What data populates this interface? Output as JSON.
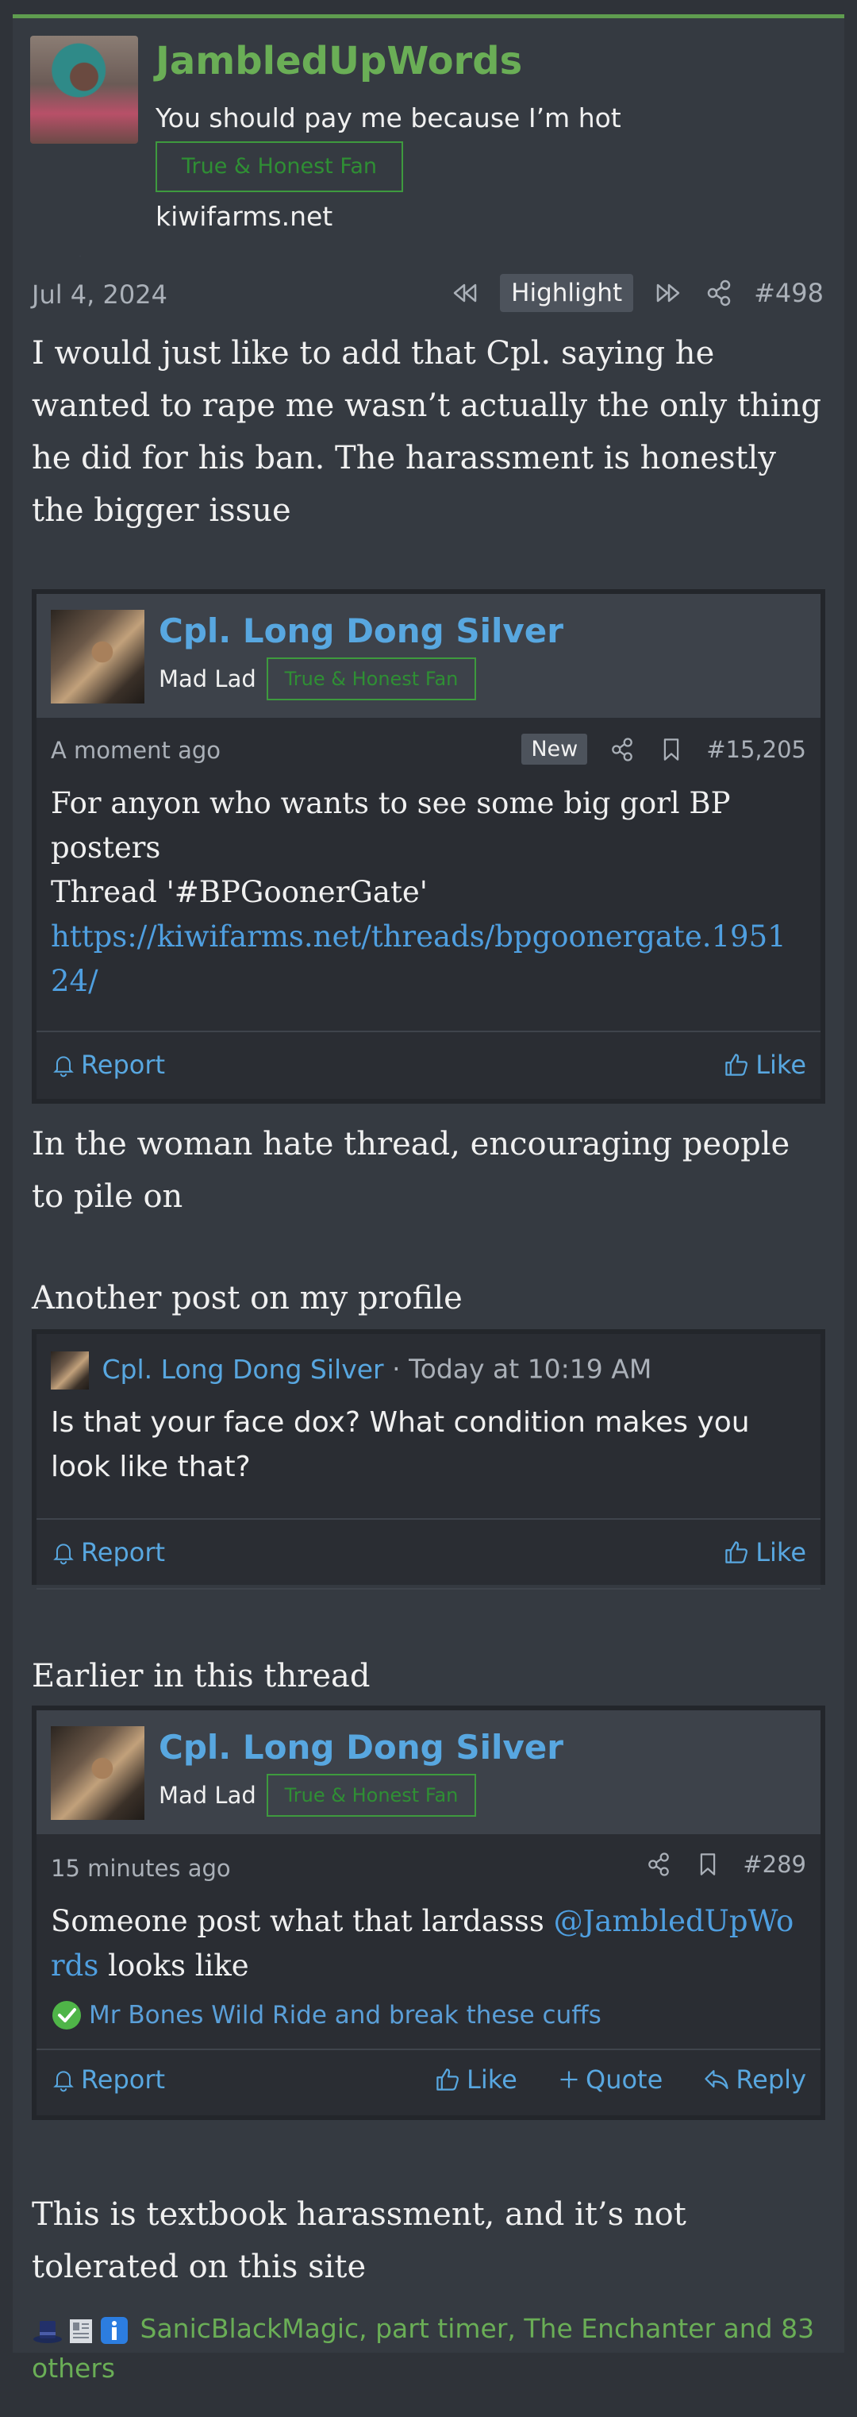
{
  "author": {
    "username": "JambledUpWords",
    "user_title": "You should pay me because I’m hot",
    "badge": "True & Honest Fan",
    "site": "kiwifarms.net"
  },
  "post_meta": {
    "date": "Jul 4, 2024",
    "highlight_label": "Highlight",
    "post_number": "#498"
  },
  "body": {
    "para1": "I would just like to add that Cpl. saying he wanted to rape me wasn’t actually the only thing he did for his ban. The harassment is honestly the bigger issue",
    "para2": "In the woman hate thread, encouraging people to pile on",
    "para3": "Another post on my profile",
    "para4": "Earlier in this thread",
    "para5": "This is textbook harassment, and it’s not tolerated on this site"
  },
  "quote1": {
    "username": "Cpl. Long Dong Silver",
    "user_title": "Mad Lad",
    "badge": "True & Honest Fan",
    "time": "A moment ago",
    "new_label": "New",
    "post_number": "#15,205",
    "line1": "For anyon who wants to see some big gorl BP posters",
    "line2": "Thread '#BPGoonerGate'",
    "link": "https://kiwifarms.net/threads/bpgoonergate.195124/",
    "report_label": "Report",
    "like_label": "Like"
  },
  "quote2": {
    "username": "Cpl. Long Dong Silver",
    "separator": " · ",
    "time": "Today at 10:19 AM",
    "text": "Is that your face dox? What condition makes you look like that?",
    "report_label": "Report",
    "like_label": "Like"
  },
  "quote3": {
    "username": "Cpl. Long Dong Silver",
    "user_title": "Mad Lad",
    "badge": "True & Honest Fan",
    "time": "15 minutes ago",
    "post_number": "#289",
    "text_before": "Someone post what that lardasss ",
    "mention": "@JambledUpWords",
    "text_after": " looks like",
    "reaction_text": "Mr Bones Wild Ride and break these cuffs",
    "report_label": "Report",
    "like_label": "Like",
    "quote_label": "Quote",
    "reply_label": "Reply"
  },
  "reactions": {
    "text": "SanicBlackMagic, part timer, The Enchanter and 83 others"
  },
  "colors": {
    "background": "#353a41",
    "accent_green": "#6aae56",
    "link_blue": "#58a7e0",
    "badge_green": "#2f8f34"
  },
  "icons": [
    "rewind-icon",
    "fast-forward-icon",
    "share-icon",
    "bookmark-icon",
    "bell-icon",
    "thumbs-up-icon",
    "plus-icon",
    "reply-icon",
    "check-circle-icon",
    "top-hat-emoji",
    "newspaper-emoji",
    "info-emoji"
  ]
}
